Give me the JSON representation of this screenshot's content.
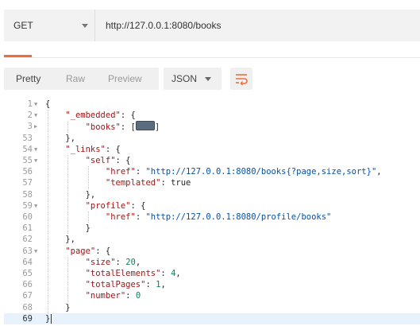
{
  "request": {
    "method": "GET",
    "url": "http://127.0.0.1:8080/books"
  },
  "toolbar": {
    "pretty": "Pretty",
    "raw": "Raw",
    "preview": "Preview",
    "language": "JSON",
    "wrap_icon": "wrap-lines-icon"
  },
  "colors": {
    "accent": "#f26b3a",
    "key": "#a31515",
    "string": "#0451a5",
    "number": "#098658"
  },
  "editor": {
    "lines": [
      {
        "num": "1",
        "fold": "open",
        "indent": 0,
        "parts": [
          {
            "t": "p",
            "v": "{"
          }
        ]
      },
      {
        "num": "2",
        "fold": "open",
        "indent": 1,
        "parts": [
          {
            "t": "k",
            "v": "\"_embedded\""
          },
          {
            "t": "p",
            "v": ": {"
          }
        ]
      },
      {
        "num": "3",
        "fold": "closed",
        "indent": 2,
        "parts": [
          {
            "t": "k",
            "v": "\"books\""
          },
          {
            "t": "p",
            "v": ": ["
          },
          {
            "t": "collapsed",
            "v": ""
          },
          {
            "t": "p",
            "v": "]"
          }
        ]
      },
      {
        "num": "53",
        "fold": "",
        "indent": 1,
        "parts": [
          {
            "t": "p",
            "v": "},"
          }
        ]
      },
      {
        "num": "54",
        "fold": "open",
        "indent": 1,
        "parts": [
          {
            "t": "k",
            "v": "\"_links\""
          },
          {
            "t": "p",
            "v": ": {"
          }
        ]
      },
      {
        "num": "55",
        "fold": "open",
        "indent": 2,
        "parts": [
          {
            "t": "k",
            "v": "\"self\""
          },
          {
            "t": "p",
            "v": ": {"
          }
        ]
      },
      {
        "num": "56",
        "fold": "",
        "indent": 3,
        "parts": [
          {
            "t": "k",
            "v": "\"href\""
          },
          {
            "t": "p",
            "v": ": "
          },
          {
            "t": "s",
            "v": "\"http://127.0.0.1:8080/books{?page,size,sort}\""
          },
          {
            "t": "p",
            "v": ","
          }
        ]
      },
      {
        "num": "57",
        "fold": "",
        "indent": 3,
        "parts": [
          {
            "t": "k",
            "v": "\"templated\""
          },
          {
            "t": "p",
            "v": ": "
          },
          {
            "t": "kw",
            "v": "true"
          }
        ]
      },
      {
        "num": "58",
        "fold": "",
        "indent": 2,
        "parts": [
          {
            "t": "p",
            "v": "},"
          }
        ]
      },
      {
        "num": "59",
        "fold": "open",
        "indent": 2,
        "parts": [
          {
            "t": "k",
            "v": "\"profile\""
          },
          {
            "t": "p",
            "v": ": {"
          }
        ]
      },
      {
        "num": "60",
        "fold": "",
        "indent": 3,
        "parts": [
          {
            "t": "k",
            "v": "\"href\""
          },
          {
            "t": "p",
            "v": ": "
          },
          {
            "t": "s",
            "v": "\"http://127.0.0.1:8080/profile/books\""
          }
        ]
      },
      {
        "num": "61",
        "fold": "",
        "indent": 2,
        "parts": [
          {
            "t": "p",
            "v": "}"
          }
        ]
      },
      {
        "num": "62",
        "fold": "",
        "indent": 1,
        "parts": [
          {
            "t": "p",
            "v": "},"
          }
        ]
      },
      {
        "num": "63",
        "fold": "open",
        "indent": 1,
        "parts": [
          {
            "t": "k",
            "v": "\"page\""
          },
          {
            "t": "p",
            "v": ": {"
          }
        ]
      },
      {
        "num": "64",
        "fold": "",
        "indent": 2,
        "parts": [
          {
            "t": "k",
            "v": "\"size\""
          },
          {
            "t": "p",
            "v": ": "
          },
          {
            "t": "n",
            "v": "20"
          },
          {
            "t": "p",
            "v": ","
          }
        ]
      },
      {
        "num": "65",
        "fold": "",
        "indent": 2,
        "parts": [
          {
            "t": "k",
            "v": "\"totalElements\""
          },
          {
            "t": "p",
            "v": ": "
          },
          {
            "t": "n",
            "v": "4"
          },
          {
            "t": "p",
            "v": ","
          }
        ]
      },
      {
        "num": "66",
        "fold": "",
        "indent": 2,
        "parts": [
          {
            "t": "k",
            "v": "\"totalPages\""
          },
          {
            "t": "p",
            "v": ": "
          },
          {
            "t": "n",
            "v": "1"
          },
          {
            "t": "p",
            "v": ","
          }
        ]
      },
      {
        "num": "67",
        "fold": "",
        "indent": 2,
        "parts": [
          {
            "t": "k",
            "v": "\"number\""
          },
          {
            "t": "p",
            "v": ": "
          },
          {
            "t": "n",
            "v": "0"
          }
        ]
      },
      {
        "num": "68",
        "fold": "",
        "indent": 1,
        "parts": [
          {
            "t": "p",
            "v": "}"
          }
        ]
      },
      {
        "num": "69",
        "fold": "",
        "indent": 0,
        "active": true,
        "parts": [
          {
            "t": "p",
            "v": "}"
          }
        ]
      }
    ]
  }
}
